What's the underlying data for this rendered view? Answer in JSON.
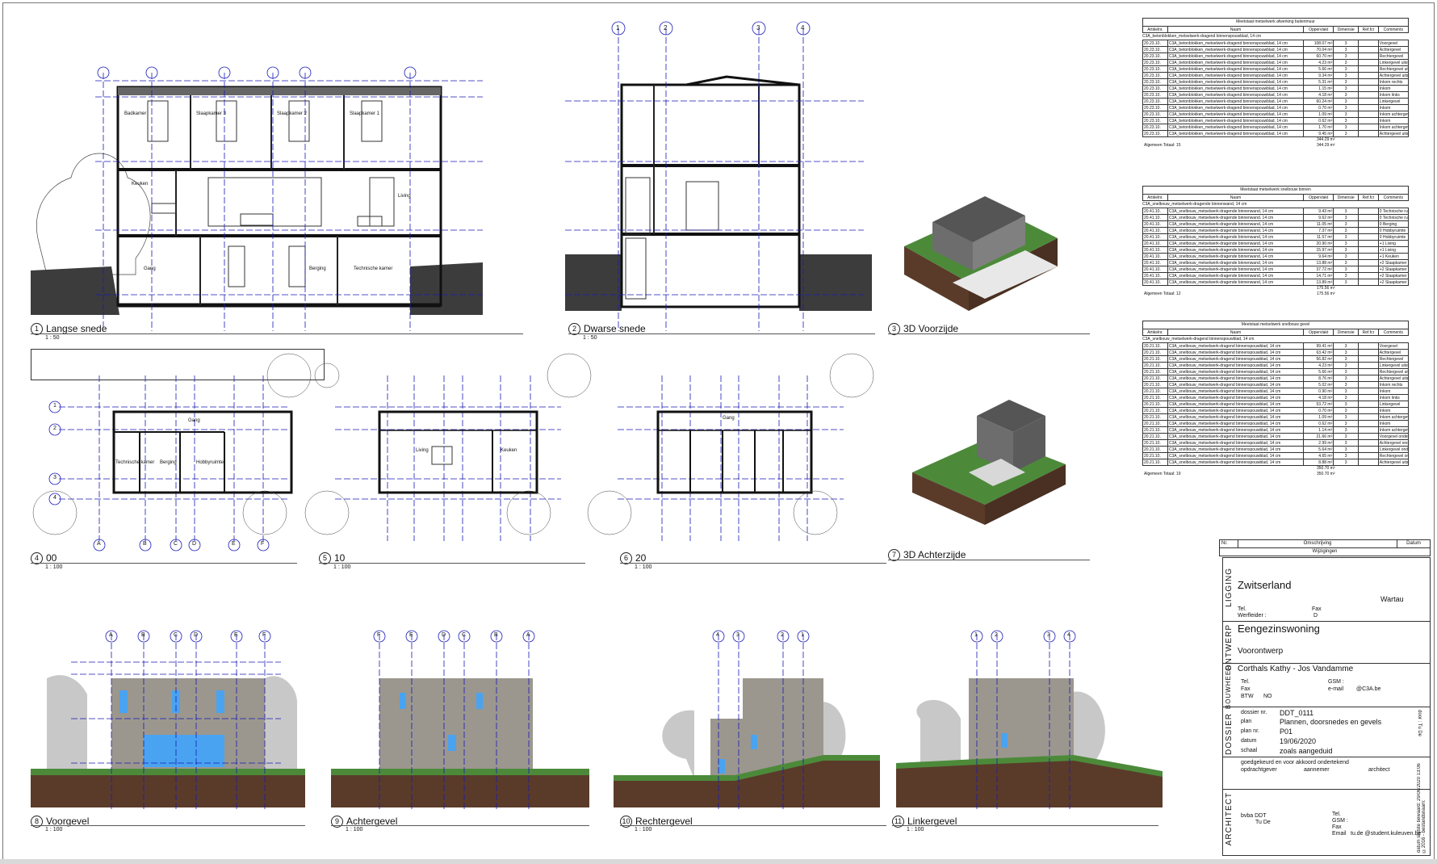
{
  "views": [
    {
      "num": "1",
      "title": "Langse snede",
      "scale": "1 : 50"
    },
    {
      "num": "2",
      "title": "Dwarse snede",
      "scale": "1 : 50"
    },
    {
      "num": "3",
      "title": "3D Voorzijde",
      "scale": ""
    },
    {
      "num": "4",
      "title": "00",
      "scale": "1 : 100"
    },
    {
      "num": "5",
      "title": "10",
      "scale": "1 : 100"
    },
    {
      "num": "6",
      "title": "20",
      "scale": "1 : 100"
    },
    {
      "num": "7",
      "title": "3D Achterzijde",
      "scale": ""
    },
    {
      "num": "8",
      "title": "Voorgevel",
      "scale": "1 : 100"
    },
    {
      "num": "9",
      "title": "Achtergevel",
      "scale": "1 : 100"
    },
    {
      "num": "10",
      "title": "Rechtergevel",
      "scale": "1 : 100"
    },
    {
      "num": "11",
      "title": "Linkergevel",
      "scale": "1 : 100"
    }
  ],
  "section1_rooms": [
    "Badkamer",
    "Slaapkamer 3",
    "Slaapkamer 2",
    "Slaapkamer 1",
    "Keuken",
    "Living",
    "Gang",
    "Berging",
    "Technische kamer"
  ],
  "plan00_rooms": [
    "Gang",
    "Technische kamer",
    "Berging",
    "Hobbyruimte"
  ],
  "plan10_rooms": [
    "Living",
    "Keuken"
  ],
  "plan20_rooms": [
    "Gang"
  ],
  "grid_letters_plan": [
    "A",
    "B",
    "C",
    "D",
    "E",
    "F"
  ],
  "grid_numbers_plan": [
    "1",
    "2",
    "3",
    "4"
  ],
  "elev_voor_grid": [
    "A",
    "B",
    "C",
    "D",
    "E",
    "F"
  ],
  "elev_achter_grid": [
    "F",
    "E",
    "D",
    "C",
    "B",
    "A"
  ],
  "elev_rechter_grid": [
    "4",
    "3",
    "2",
    "1"
  ],
  "elev_linker_grid": [
    "1",
    "2",
    "3",
    "4"
  ],
  "section2_grid": [
    "1",
    "2",
    "3",
    "4"
  ],
  "schedules": [
    {
      "title": "Meetstaat metselwerk afwerking buitenmuur",
      "headers": [
        "Artikelnr.",
        "Naam",
        "Oppervlakt",
        "Dimensie",
        "Ref.fcr",
        "Comments"
      ],
      "group": "C3A_betonblokken_metselwerk-dragend binnenspouwblad, 14 cm",
      "rows": [
        [
          "20.23.10.",
          "C3A_betonblokken_metselwerk-dragend binnenspouwblad, 14 cm",
          "108.07 m²",
          "3",
          "",
          "Voorgevel"
        ],
        [
          "20.23.10.",
          "C3A_betonblokken_metselwerk-dragend binnenspouwblad, 14 cm",
          "70.04 m²",
          "3",
          "",
          "Achtergevel"
        ],
        [
          "20.23.10.",
          "C3A_betonblokken_metselwerk-dragend binnenspouwblad, 14 cm",
          "60.70 m²",
          "3",
          "",
          "Rechtergevel"
        ],
        [
          "20.23.10.",
          "C3A_betonblokken_metselwerk-dragend binnenspouwblad, 14 cm",
          "4.23 m²",
          "3",
          "",
          "Linkergevel uitsteek"
        ],
        [
          "20.23.10.",
          "C3A_betonblokken_metselwerk-dragend binnenspouwblad, 14 cm",
          "5.66 m²",
          "3",
          "",
          "Rechtergevel uitsteek"
        ],
        [
          "20.23.10.",
          "C3A_betonblokken_metselwerk-dragend binnenspouwblad, 14 cm",
          "9.34 m²",
          "3",
          "",
          "Achtergevel uitsteek rechts"
        ],
        [
          "20.23.10.",
          "C3A_betonblokken_metselwerk-dragend binnenspouwblad, 14 cm",
          "5.31 m²",
          "3",
          "",
          "Inkom rechts"
        ],
        [
          "20.23.10.",
          "C3A_betonblokken_metselwerk-dragend binnenspouwblad, 14 cm",
          "1.15 m²",
          "3",
          "",
          "Inkom"
        ],
        [
          "20.23.10.",
          "C3A_betonblokken_metselwerk-dragend binnenspouwblad, 14 cm",
          "4.18 m²",
          "3",
          "",
          "Inkom links"
        ],
        [
          "20.23.10.",
          "C3A_betonblokken_metselwerk-dragend binnenspouwblad, 14 cm",
          "60.24 m²",
          "3",
          "",
          "Linkergevel"
        ],
        [
          "20.23.10.",
          "C3A_betonblokken_metselwerk-dragend binnenspouwblad, 14 cm",
          "0.70 m²",
          "3",
          "",
          "Inkom"
        ],
        [
          "20.23.10.",
          "C3A_betonblokken_metselwerk-dragend binnenspouwblad, 14 cm",
          "1.09 m²",
          "3",
          "",
          "Inkom achtergevel"
        ],
        [
          "20.23.10.",
          "C3A_betonblokken_metselwerk-dragend binnenspouwblad, 14 cm",
          "0.62 m²",
          "3",
          "",
          "Inkom"
        ],
        [
          "20.23.10.",
          "C3A_betonblokken_metselwerk-dragend binnenspouwblad, 14 cm",
          "1.70 m²",
          "3",
          "",
          "Inkom achtergevel"
        ],
        [
          "20.23.10.",
          "C3A_betonblokken_metselwerk-dragend binnenspouwblad, 14 cm",
          "9.45 m²",
          "3",
          "",
          "Achtergevel uitsteek links"
        ]
      ],
      "subtotal": "344.29 m²",
      "total_label": "Algemeen Totaal: 15",
      "total": "344.29 m²"
    },
    {
      "title": "Meetstaat metselwerk snelbouw binnen",
      "headers": [
        "Artikelnr.",
        "Naam",
        "Oppervlakt",
        "Dimensie",
        "Ref.fcr",
        "Comments"
      ],
      "group": "C3A_snelbouw_metselwerk-dragende binnenwand, 14 cm",
      "rows": [
        [
          "20.41.10.",
          "C3A_snelbouw_metselwerk-dragende binnenwand, 14 cm",
          "9.43 m²",
          "3",
          "",
          "0 Technische ruimte"
        ],
        [
          "20.41.10.",
          "C3A_snelbouw_metselwerk-dragende binnenwand, 14 cm",
          "9.62 m²",
          "3",
          "",
          "0 Technische ruimte"
        ],
        [
          "20.41.10.",
          "C3A_snelbouw_metselwerk-dragende binnenwand, 14 cm",
          "11.05 m²",
          "3",
          "",
          "0 Berging"
        ],
        [
          "20.41.10.",
          "C3A_snelbouw_metselwerk-dragende binnenwand, 14 cm",
          "7.37 m²",
          "3",
          "",
          "0 Hobbyruimte"
        ],
        [
          "20.41.10.",
          "C3A_snelbouw_metselwerk-dragende binnenwand, 14 cm",
          "11.57 m²",
          "3",
          "",
          "0 Hobbyruimte"
        ],
        [
          "20.41.10.",
          "C3A_snelbouw_metselwerk-dragende binnenwand, 14 cm",
          "20.90 m²",
          "3",
          "",
          "+1 Living"
        ],
        [
          "20.41.10.",
          "C3A_snelbouw_metselwerk-dragende binnenwand, 14 cm",
          "15.97 m²",
          "3",
          "",
          "+1 Living"
        ],
        [
          "20.41.10.",
          "C3A_snelbouw_metselwerk-dragende binnenwand, 14 cm",
          "9.64 m²",
          "3",
          "",
          "+1 Keuken"
        ],
        [
          "20.41.10.",
          "C3A_snelbouw_metselwerk-dragende binnenwand, 14 cm",
          "13.88 m²",
          "3",
          "",
          "+2 Slaapkamer"
        ],
        [
          "20.41.10.",
          "C3A_snelbouw_metselwerk-dragende binnenwand, 14 cm",
          "37.72 m²",
          "3",
          "",
          "+2 Slaapkamer"
        ],
        [
          "20.41.10.",
          "C3A_snelbouw_metselwerk-dragende binnenwand, 14 cm",
          "14.71 m²",
          "3",
          "",
          "+2 Slaapkamer"
        ],
        [
          "20.41.10.",
          "C3A_snelbouw_metselwerk-dragende binnenwand, 14 cm",
          "13.89 m²",
          "3",
          "",
          "+2 Slaapkamer"
        ]
      ],
      "subtotal": "175.56 m²",
      "total_label": "Algemeen Totaal: 12",
      "total": "175.56 m²"
    },
    {
      "title": "Meetstaat metselwerk snelbouw gevel",
      "headers": [
        "Artikelnr.",
        "Naam",
        "Oppervlakt",
        "Dimensie",
        "Ref.fcr",
        "Comments"
      ],
      "group": "C3A_snelbouw_metselwerk-dragend binnenspouwblad, 14 cm",
      "rows": [
        [
          "20.21.10.",
          "C3A_snelbouw_metselwerk-dragend binnenspouwblad, 14 cm",
          "99.41 m²",
          "3",
          "",
          "Voorgevel"
        ],
        [
          "20.21.10.",
          "C3A_snelbouw_metselwerk-dragend binnenspouwblad, 14 cm",
          "63.42 m²",
          "3",
          "",
          "Achtergevel"
        ],
        [
          "20.21.10.",
          "C3A_snelbouw_metselwerk-dragend binnenspouwblad, 14 cm",
          "56.82 m²",
          "3",
          "",
          "Rechtergevel"
        ],
        [
          "20.21.10.",
          "C3A_snelbouw_metselwerk-dragend binnenspouwblad, 14 cm",
          "4.23 m²",
          "3",
          "",
          "Linkergevel uitsteek"
        ],
        [
          "20.21.10.",
          "C3A_snelbouw_metselwerk-dragend binnenspouwblad, 14 cm",
          "5.66 m²",
          "3",
          "",
          "Rechtergevel uitsteek"
        ],
        [
          "20.21.10.",
          "C3A_snelbouw_metselwerk-dragend binnenspouwblad, 14 cm",
          "8.76 m²",
          "3",
          "",
          "Achtergevel uitsteek rechts"
        ],
        [
          "20.21.10.",
          "C3A_snelbouw_metselwerk-dragend binnenspouwblad, 14 cm",
          "5.02 m²",
          "3",
          "",
          "Inkom rechts"
        ],
        [
          "20.21.10.",
          "C3A_snelbouw_metselwerk-dragend binnenspouwblad, 14 cm",
          "0.90 m²",
          "3",
          "",
          "Inkom"
        ],
        [
          "20.21.10.",
          "C3A_snelbouw_metselwerk-dragend binnenspouwblad, 14 cm",
          "4.18 m²",
          "3",
          "",
          "Inkom links"
        ],
        [
          "20.21.10.",
          "C3A_snelbouw_metselwerk-dragend binnenspouwblad, 14 cm",
          "53.72 m²",
          "3",
          "",
          "Linkergevel"
        ],
        [
          "20.21.10.",
          "C3A_snelbouw_metselwerk-dragend binnenspouwblad, 14 cm",
          "0.70 m²",
          "3",
          "",
          "Inkom"
        ],
        [
          "20.21.10.",
          "C3A_snelbouw_metselwerk-dragend binnenspouwblad, 14 cm",
          "1.09 m²",
          "3",
          "",
          "Inkom achtergevel"
        ],
        [
          "20.21.10.",
          "C3A_snelbouw_metselwerk-dragend binnenspouwblad, 14 cm",
          "0.62 m²",
          "3",
          "",
          "Inkom"
        ],
        [
          "20.21.10.",
          "C3A_snelbouw_metselwerk-dragend binnenspouwblad, 14 cm",
          "1.14 m²",
          "3",
          "",
          "Inkom achtergevel"
        ],
        [
          "20.21.10.",
          "C3A_snelbouw_metselwerk-dragend binnenspouwblad, 14 cm",
          "21.66 m²",
          "3",
          "",
          "Voorgevel ondergronds"
        ],
        [
          "20.21.10.",
          "C3A_snelbouw_metselwerk-dragend binnenspouwblad, 14 cm",
          "2.99 m²",
          "3",
          "",
          "Achtergevel ondergronds"
        ],
        [
          "20.21.10.",
          "C3A_snelbouw_metselwerk-dragend binnenspouwblad, 14 cm",
          "5.64 m²",
          "3",
          "",
          "Linkergevel ondergronds"
        ],
        [
          "20.21.10.",
          "C3A_snelbouw_metselwerk-dragend binnenspouwblad, 14 cm",
          "4.65 m²",
          "3",
          "",
          "Rechtergevel ondergronds"
        ],
        [
          "20.21.10.",
          "C3A_snelbouw_metselwerk-dragend binnenspouwblad, 14 cm",
          "8.88 m²",
          "3",
          "",
          "Achtergevel uitsteek links"
        ]
      ],
      "subtotal": "350.70 m²",
      "total_label": "Algemeen Totaal: 19",
      "total": "350.70 m²"
    }
  ],
  "revisions": {
    "headers": [
      "Nr.",
      "Omschrijving",
      "Datum"
    ],
    "title": "Wijzigingen"
  },
  "titleblock": {
    "ligging_label": "LIGGING",
    "country": "Zwitserland",
    "place": "Wartau",
    "tel": "Tel.",
    "fax": "Fax",
    "werfleider": "Werfleider :",
    "werfleider_val": "D",
    "ontwerp_label": "ONTWERP",
    "project": "Eengezinswoning",
    "phase": "Voorontwerp",
    "bouwheer_label": "BOUWHEER",
    "client": "Corthals Kathy - Jos Vandamme",
    "client_tel": "Tel.",
    "client_fax": "Fax",
    "client_btw": "BTW",
    "client_btw_val": "NO",
    "client_gsm": "GSM :",
    "client_email": "e-mail",
    "client_email_val": "@C3A.be",
    "dossier_label": "DOSSIER",
    "dossier_nr_label": "dossier nr.",
    "dossier_nr": "DDT_0111",
    "plan_label": "plan",
    "plan": "Plannen, doorsnedes en gevels",
    "plan_nr_label": "plan nr.",
    "plan_nr": "P01",
    "datum_label": "datum",
    "datum": "19/06/2020",
    "schaal_label": "schaal",
    "schaal": "zoals aangeduid",
    "door": "door : Tu De",
    "approval": "goedgekeurd en voor akkoord ondertekend",
    "sig_opdracht": "opdrachtgever",
    "sig_aannemer": "aannemer",
    "sig_architect": "architect",
    "architect_label": "ARCHITECT",
    "arch_firm": "bvba DDT",
    "arch_name": "Tu De",
    "arch_tel": "Tel.",
    "arch_gsm": "GSM :",
    "arch_fax": "Fax",
    "arch_email": "Email",
    "arch_email_val": "tu.de @student.kuleuven.be",
    "side_note": "datum laatste bewaard: 29/06/2020 13:06 ©2016 - bestandsnaam:"
  },
  "colors": {
    "grid": "#1a1ab8",
    "ground": "#5a3b2a",
    "grass": "#4c8a3a",
    "wall": "#9b978e"
  }
}
